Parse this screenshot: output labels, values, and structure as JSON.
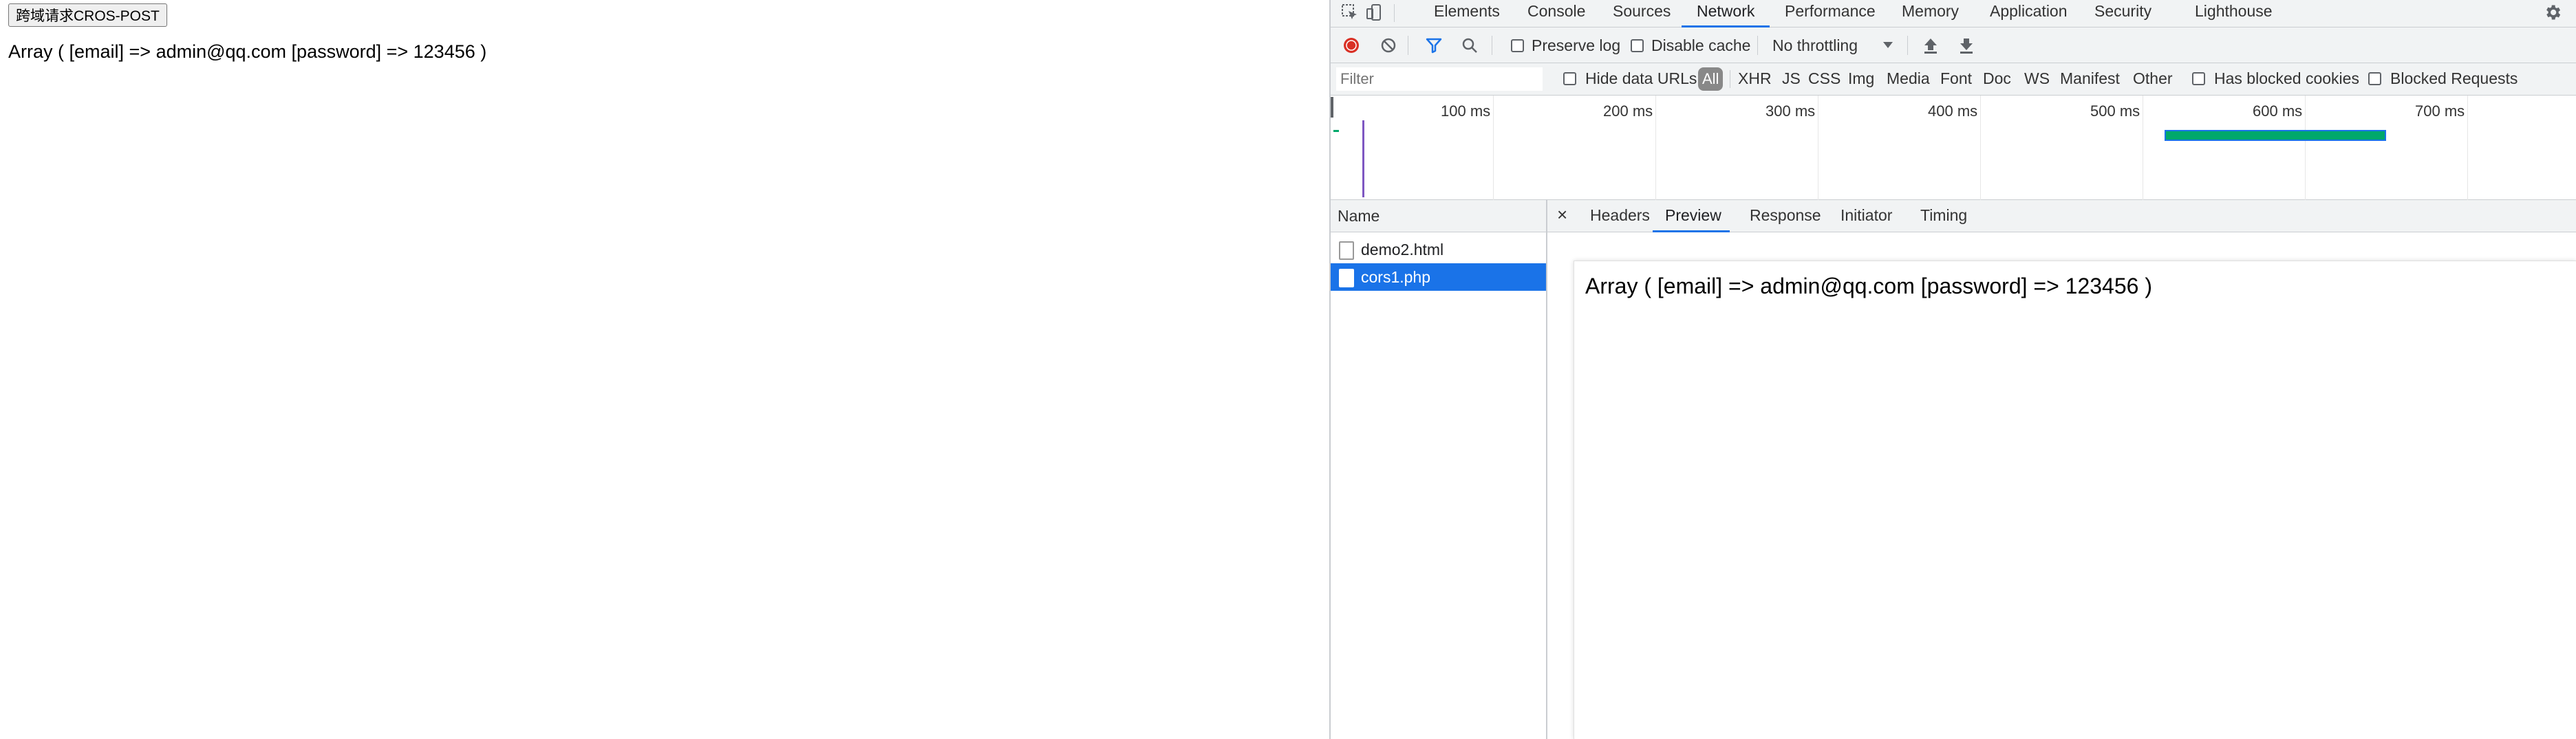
{
  "page": {
    "button_label": "跨域请求CROS-POST",
    "result_text": "Array ( [email] => admin@qq.com [password] => 123456 )"
  },
  "devtools": {
    "tabs": [
      {
        "label": "Elements"
      },
      {
        "label": "Console"
      },
      {
        "label": "Sources"
      },
      {
        "label": "Network"
      },
      {
        "label": "Performance"
      },
      {
        "label": "Memory"
      },
      {
        "label": "Application"
      },
      {
        "label": "Security"
      },
      {
        "label": "Lighthouse"
      }
    ],
    "active_tab": "Network",
    "toolbar": {
      "preserve_log_label": "Preserve log",
      "disable_cache_label": "Disable cache",
      "throttling_value": "No throttling",
      "icons": [
        "record-icon",
        "clear-icon",
        "filter-icon",
        "search-icon",
        "import-icon",
        "export-icon"
      ]
    },
    "filterbar": {
      "filter_placeholder": "Filter",
      "hide_data_urls_label": "Hide data URLs",
      "types": [
        "All",
        "XHR",
        "JS",
        "CSS",
        "Img",
        "Media",
        "Font",
        "Doc",
        "WS",
        "Manifest",
        "Other"
      ],
      "active_type": "All",
      "has_blocked_cookies_label": "Has blocked cookies",
      "blocked_requests_label": "Blocked Requests"
    },
    "overview": {
      "ticks": [
        "100 ms",
        "200 ms",
        "300 ms",
        "400 ms",
        "500 ms",
        "600 ms",
        "700 ms"
      ],
      "colors": {
        "waiting": "#00a86b",
        "download": "#1a73e8",
        "marker": "#7e57c2"
      }
    },
    "requests": {
      "header": "Name",
      "items": [
        {
          "name": "demo2.html",
          "selected": false
        },
        {
          "name": "cors1.php",
          "selected": true
        }
      ]
    },
    "detail": {
      "close_glyph": "×",
      "tabs": [
        {
          "label": "Headers"
        },
        {
          "label": "Preview"
        },
        {
          "label": "Response"
        },
        {
          "label": "Initiator"
        },
        {
          "label": "Timing"
        }
      ],
      "active_tab": "Preview",
      "preview_text": "Array ( [email] => admin@qq.com [password] => 123456 )"
    },
    "accent_color": "#1a73e8"
  }
}
